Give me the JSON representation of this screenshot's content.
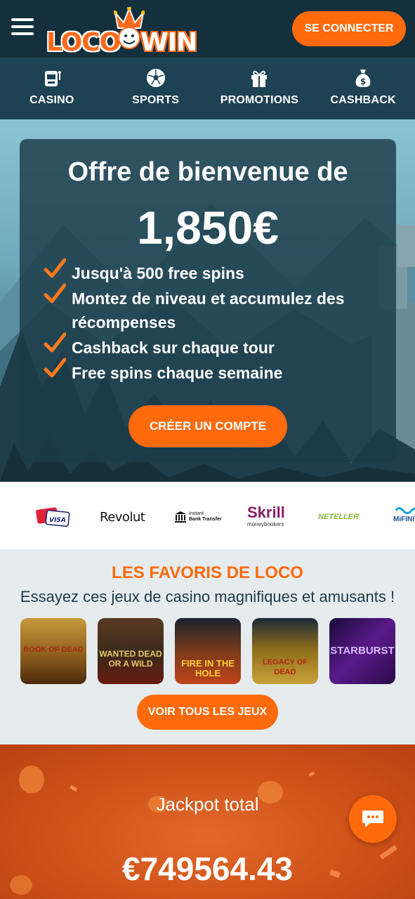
{
  "header": {
    "logo_left": "LOCO",
    "logo_right": "WIN",
    "connect_label": "SE CONNECTER"
  },
  "nav": {
    "items": [
      {
        "label": "CASINO",
        "icon": "slot-machine-icon"
      },
      {
        "label": "SPORTS",
        "icon": "soccer-ball-icon"
      },
      {
        "label": "PROMOTIONS",
        "icon": "gift-icon"
      },
      {
        "label": "CASHBACK",
        "icon": "money-bag-icon"
      }
    ]
  },
  "hero": {
    "title": "Offre de bienvenue de",
    "amount": "1,850€",
    "benefits": [
      "Jusqu'à 500 free spins",
      "Montez de niveau et accumulez des récompenses",
      "Cashback sur chaque tour",
      "Free spins chaque semaine"
    ],
    "cta_label": "CRÉER UN COMPTE"
  },
  "payments": {
    "visa": "VISA",
    "revolut": "Revolut",
    "bank_line1": "Instant",
    "bank_line2": "Bank Transfer",
    "skrill": "Skrill",
    "skrill_sub": "moneybookers",
    "neteller": "NETELLER",
    "mifinity": "MiFINITY"
  },
  "favorites": {
    "title": "LES FAVORIS DE LOCO",
    "subtitle": "Essayez ces jeux de casino magnifiques et amusants !",
    "games": [
      {
        "name": "BOOK OF DEAD"
      },
      {
        "name": "WANTED DEAD OR A WILD"
      },
      {
        "name": "FIRE IN THE HOLE"
      },
      {
        "name": "LEGACY OF DEAD"
      },
      {
        "name": "STARBURST"
      }
    ],
    "all_games_label": "VOIR TOUS LES JEUX"
  },
  "jackpot": {
    "label": "Jackpot total",
    "amount": "€749564.43"
  },
  "colors": {
    "accent": "#ff6a0d",
    "header_bg": "#15303d",
    "nav_bg": "#1d4253"
  }
}
